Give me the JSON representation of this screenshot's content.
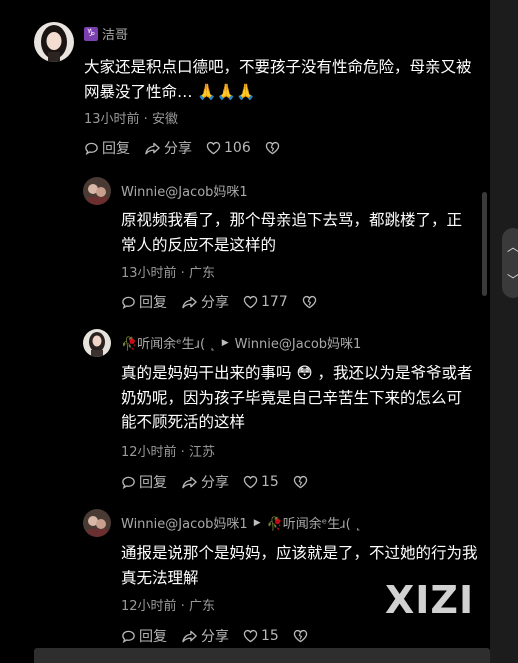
{
  "top_partial": "",
  "comments": [
    {
      "author": "洁哥",
      "zodiac_glyph": "♑",
      "text": "大家还是积点口德吧，不要孩子没有性命危险，母亲又被网暴没了性命… 🙏🙏🙏",
      "meta": "13小时前 · 安徽",
      "reply_label": "回复",
      "share_label": "分享",
      "likes": "106"
    },
    {
      "author": "Winnie@Jacob妈咪1",
      "text": "原视频我看了，那个母亲追下去骂，都跳楼了，正常人的反应不是这样的",
      "meta": "13小时前 · 广东",
      "reply_label": "回复",
      "share_label": "分享",
      "likes": "177"
    },
    {
      "author": "🥀听闻余ᵉ生ɹ( ˛",
      "reply_to": "Winnie@Jacob妈咪1",
      "text": "真的是妈妈干出来的事吗 😳 ，我还以为是爷爷或者奶奶呢，因为孩子毕竟是自己辛苦生下来的怎么可能不顾死活的这样",
      "meta": "12小时前 · 江苏",
      "reply_label": "回复",
      "share_label": "分享",
      "likes": "15"
    },
    {
      "author": "Winnie@Jacob妈咪1",
      "reply_to": "🥀听闻余ᵉ生ɹ( ˛",
      "text": "通报是说那个是妈妈，应该就是了，不过她的行为我真无法理解",
      "meta": "12小时前 · 广东",
      "reply_label": "回复",
      "share_label": "分享",
      "likes": "15"
    }
  ],
  "watermark": "XIZI",
  "side_controls": {
    "up": "︿",
    "down": "﹀"
  }
}
